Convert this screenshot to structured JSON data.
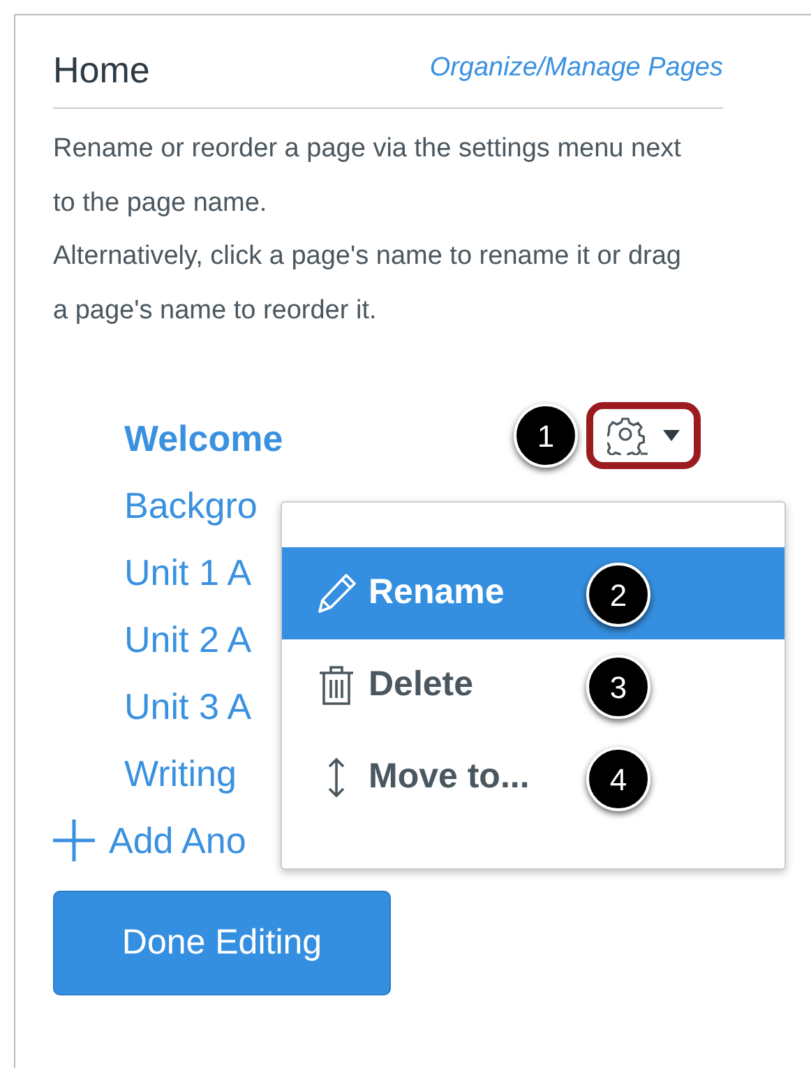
{
  "header": {
    "title": "Home",
    "link": "Organize/Manage Pages"
  },
  "description": [
    "Rename or reorder a page via the settings menu next to the page name.",
    "Alternatively, click a page's name to rename it or drag a page's name to reorder it."
  ],
  "pages": [
    {
      "label": "Welcome",
      "front_page": true,
      "settings": true,
      "callout": "1"
    },
    {
      "label": "Backgro",
      "front_page": false,
      "settings": false
    },
    {
      "label": "Unit 1 A",
      "front_page": false,
      "settings": false
    },
    {
      "label": "Unit 2 A",
      "front_page": false,
      "settings": false
    },
    {
      "label": "Unit 3 A",
      "front_page": false,
      "settings": false
    },
    {
      "label": "Writing",
      "front_page": false,
      "settings": false
    }
  ],
  "add_page": "Add Ano",
  "settings_menu": [
    {
      "kind": "pencil",
      "label": "Rename",
      "selected": true,
      "callout": "2"
    },
    {
      "kind": "trash",
      "label": "Delete",
      "selected": false,
      "callout": "3"
    },
    {
      "kind": "move",
      "label": "Move to...",
      "selected": false,
      "callout": "4"
    }
  ],
  "done_button": "Done Editing"
}
